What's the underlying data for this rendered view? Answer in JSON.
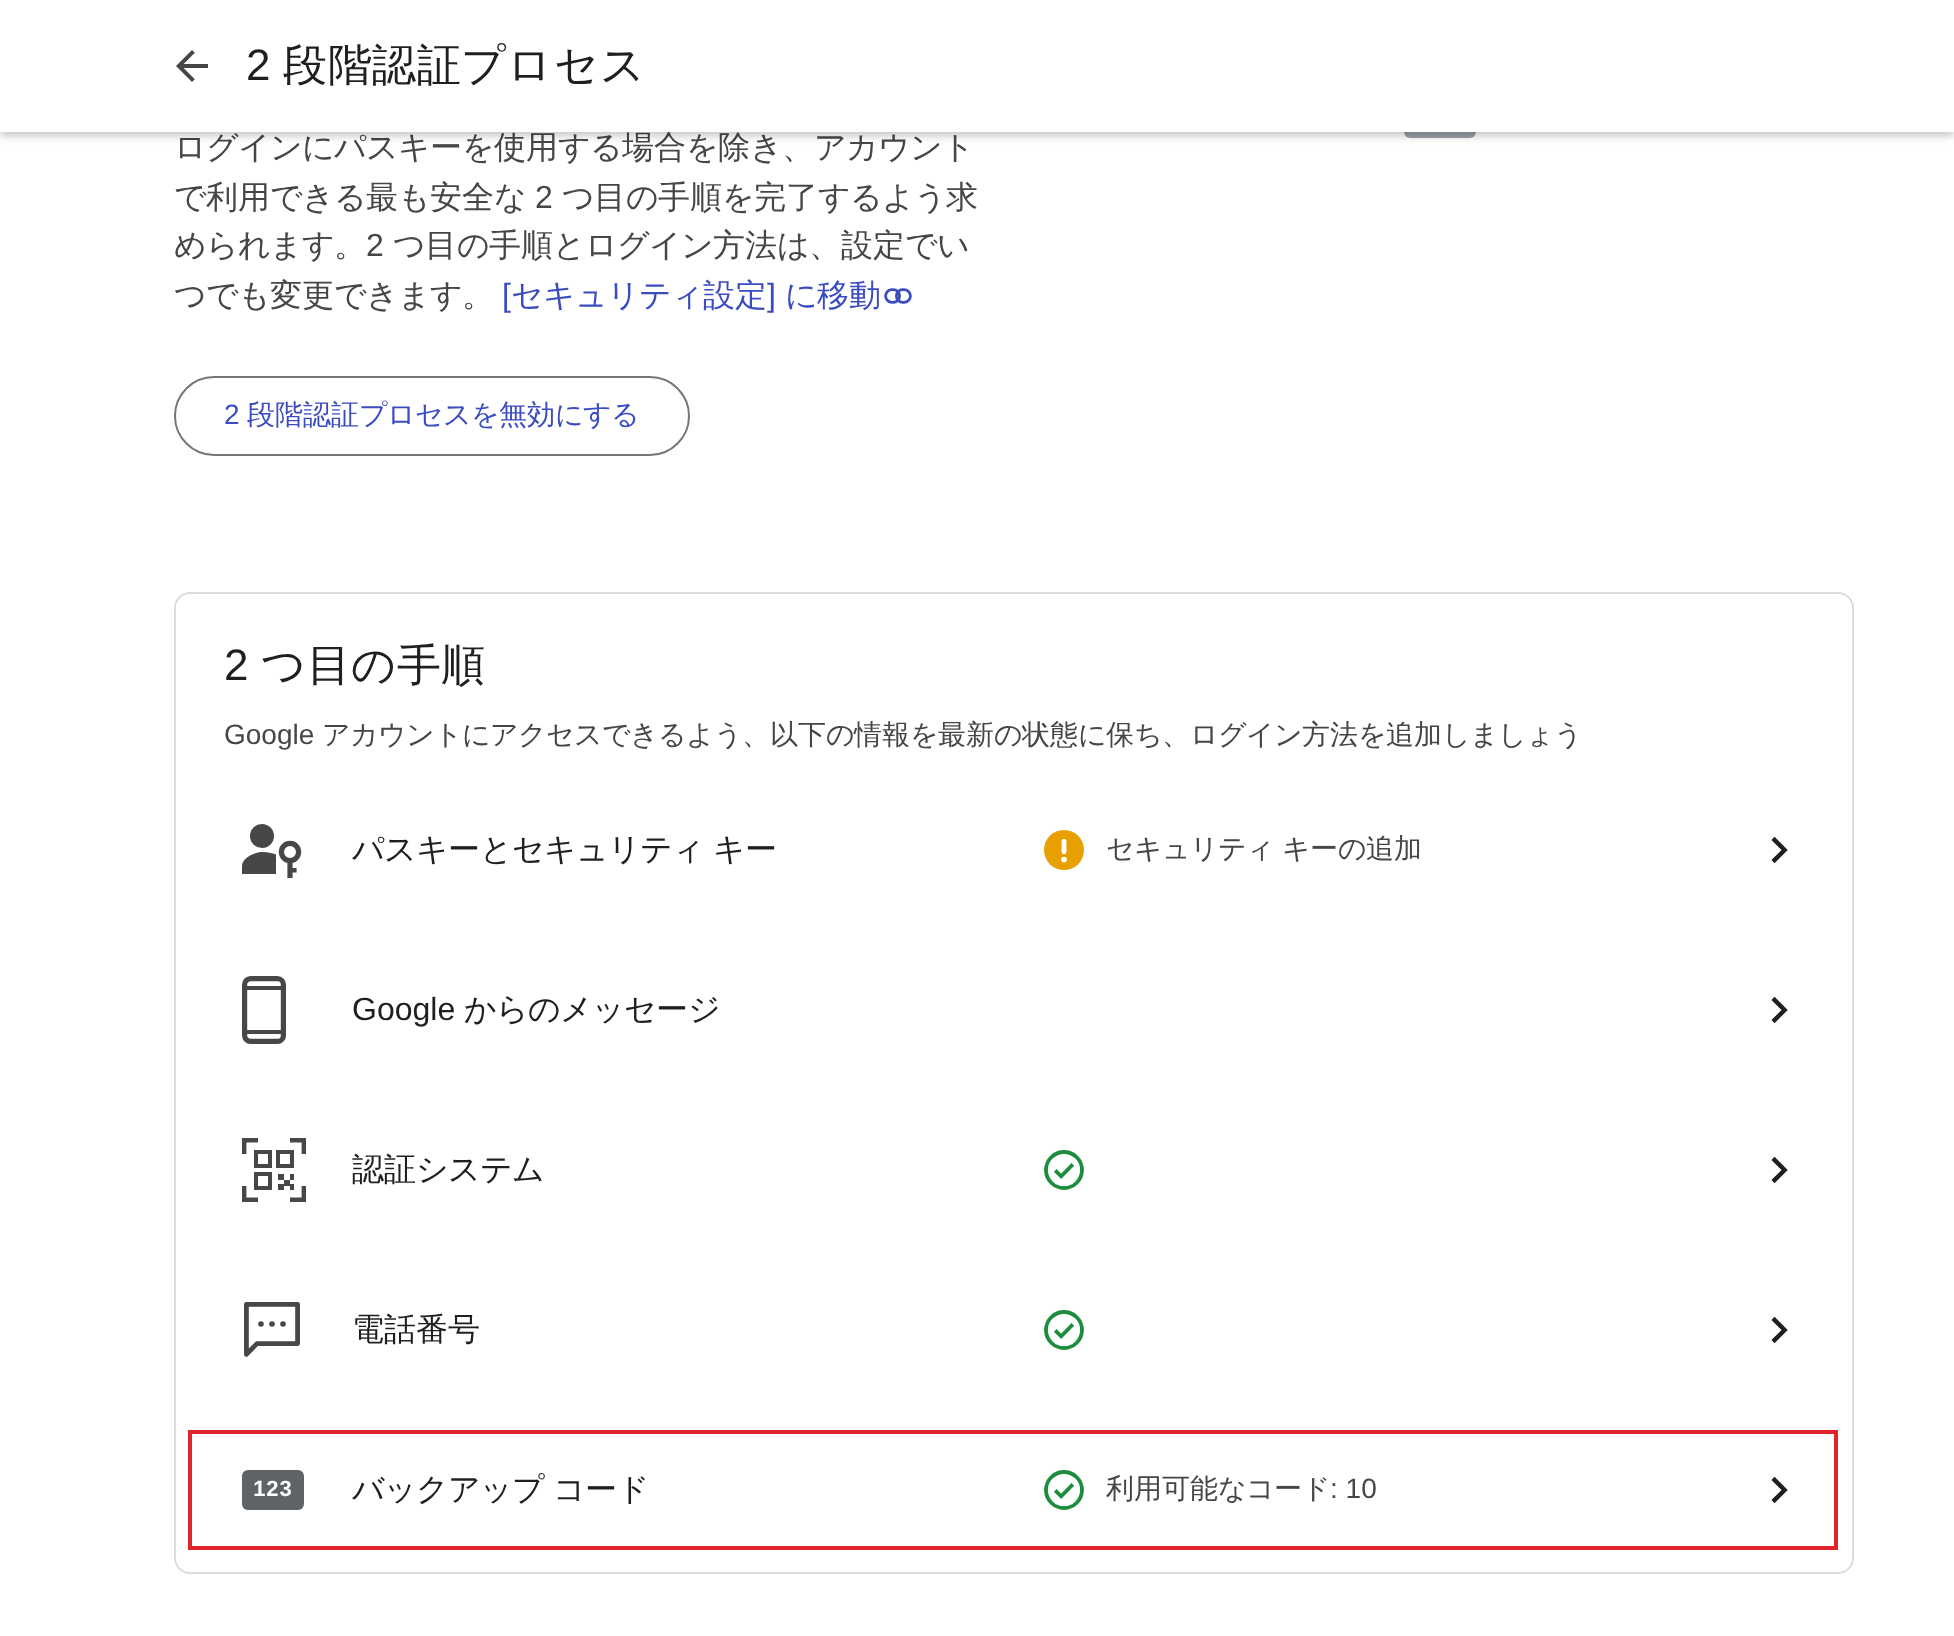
{
  "header": {
    "title": "2 段階認証プロセス"
  },
  "intro": {
    "text": "ログインにパスキーを使用する場合を除き、アカウントで利用できる最も安全な 2 つ目の手順を完了するよう求められます。2 つ目の手順とログイン方法は、設定でいつでも変更できます。",
    "link": "[セキュリティ設定] に移動"
  },
  "turn_off_button": "2 段階認証プロセスを無効にする",
  "second_steps": {
    "title": "2 つ目の手順",
    "subtitle": "Google アカウントにアクセスできるよう、以下の情報を最新の状態に保ち、ログイン方法を追加しましょう",
    "items": [
      {
        "kind": "passkey",
        "label": "パスキーとセキュリティ キー",
        "status": {
          "kind": "warning",
          "text": "セキュリティ キーの追加"
        },
        "highlighted": false
      },
      {
        "kind": "prompt",
        "label": "Google からのメッセージ",
        "highlighted": false
      },
      {
        "kind": "authenticator",
        "label": "認証システム",
        "status": {
          "kind": "ok"
        },
        "highlighted": false
      },
      {
        "kind": "phone",
        "label": "電話番号",
        "status": {
          "kind": "ok"
        },
        "highlighted": false
      },
      {
        "kind": "backup",
        "label": "バックアップ コード",
        "badge": "123",
        "status": {
          "kind": "ok",
          "text": "利用可能なコード: 10"
        },
        "highlighted": true
      }
    ]
  }
}
